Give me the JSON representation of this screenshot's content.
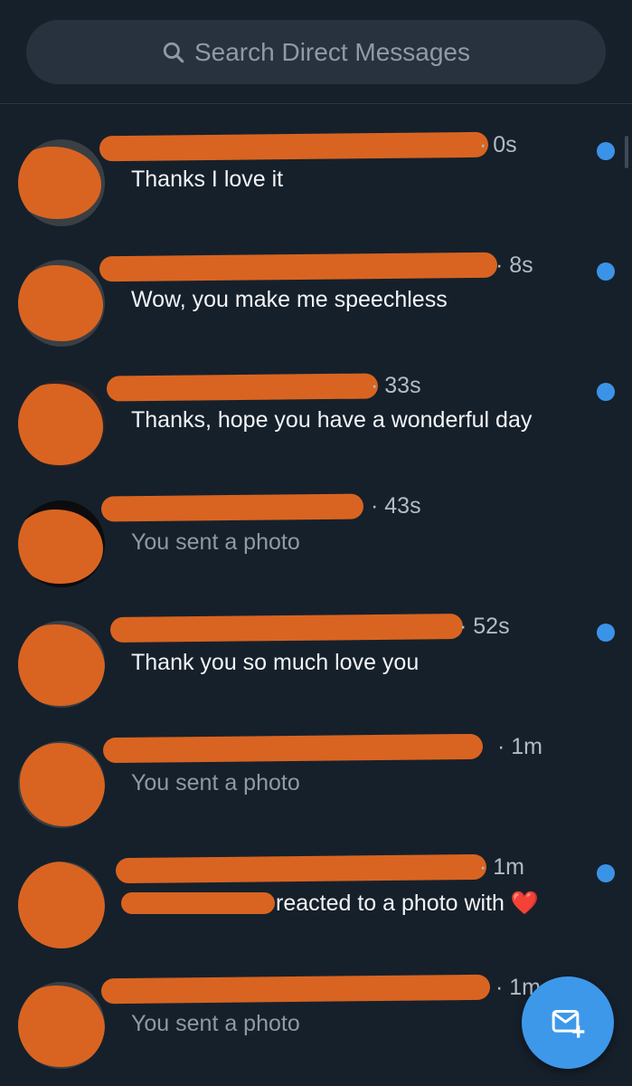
{
  "search": {
    "placeholder": "Search Direct Messages"
  },
  "conversations": [
    {
      "time": "· 0s",
      "message": "Thanks I love it",
      "unread": true
    },
    {
      "time": "· 8s",
      "message": "Wow, you make me speechless",
      "unread": true
    },
    {
      "time": "· 33s",
      "message": "Thanks, hope you have a wonderful day",
      "unread": true
    },
    {
      "time": "· 43s",
      "message": "You sent a photo",
      "unread": false
    },
    {
      "time": "· 52s",
      "message": "Thank you so much love you",
      "unread": true
    },
    {
      "time": "· 1m",
      "message": "You sent a photo",
      "unread": false
    },
    {
      "time": "· 1m",
      "message": "reacted to a photo with ❤️",
      "unread": true
    },
    {
      "time": "· 1m",
      "message": "You sent a photo",
      "unread": false
    }
  ],
  "colors": {
    "background": "#16202b",
    "accent": "#3b93e8",
    "redaction": "#d96421"
  },
  "icons": {
    "search": "search-icon",
    "compose": "new-message-icon"
  }
}
